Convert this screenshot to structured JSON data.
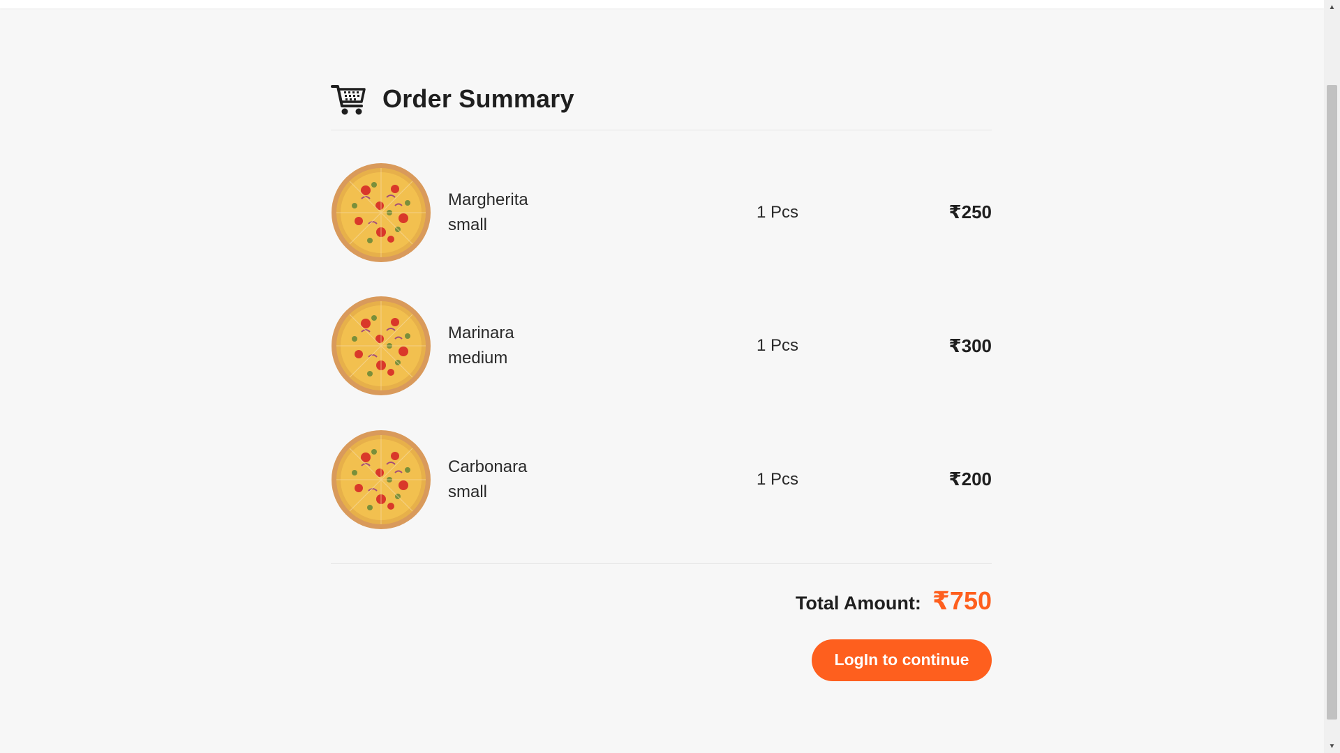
{
  "order": {
    "title": "Order Summary",
    "cart_icon": "shopping-cart-icon",
    "items": [
      {
        "name": "Margherita",
        "size": "small",
        "qty": "1 Pcs",
        "price": "₹250"
      },
      {
        "name": "Marinara",
        "size": "medium",
        "qty": "1 Pcs",
        "price": "₹300"
      },
      {
        "name": "Carbonara",
        "size": "small",
        "qty": "1 Pcs",
        "price": "₹200"
      }
    ],
    "total_label": "Total Amount:",
    "total_value": "₹750",
    "login_label": "LogIn to continue"
  },
  "colors": {
    "accent": "#fe5f1e",
    "background": "#f7f7f7",
    "text": "#1f1f1f"
  }
}
